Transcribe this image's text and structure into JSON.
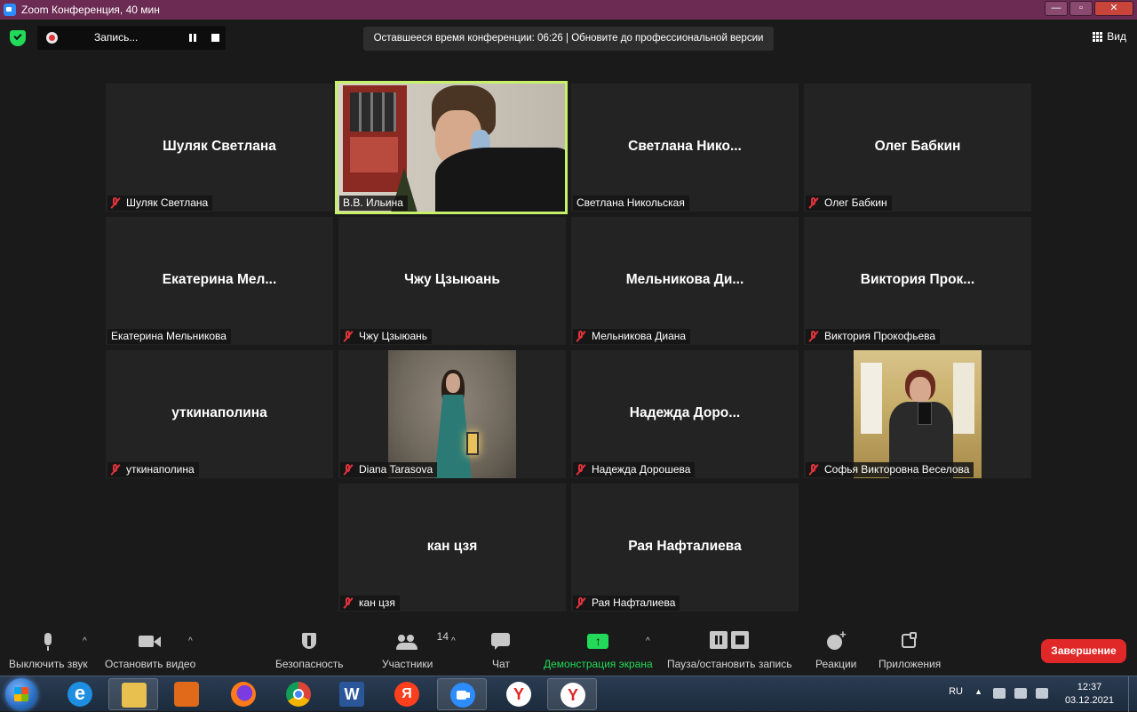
{
  "window": {
    "title": "Zoom Конференция, 40 мин",
    "controls": {
      "minimize": "—",
      "restore": "▫",
      "close": "✕"
    }
  },
  "topbar": {
    "recording_label": "Запись...",
    "notice": "Оставшееся время конференции: 06:26 | Обновите до профессиональной версии",
    "view_label": "Вид"
  },
  "tiles": [
    {
      "big_name": "Шуляк Светлана",
      "tag": "Шуляк Светлана"
    },
    {
      "big_name": "",
      "tag": "В.В. Ильина"
    },
    {
      "big_name": "Светлана  Нико...",
      "tag": "Светлана Никольская"
    },
    {
      "big_name": "Олег Бабкин",
      "tag": "Олег Бабкин"
    },
    {
      "big_name": "Екатерина  Мел...",
      "tag": "Екатерина Мельникова"
    },
    {
      "big_name": "Чжу Цзыюань",
      "tag": "Чжу Цзыюань"
    },
    {
      "big_name": "Мельникова  Ди...",
      "tag": "Мельникова Диана"
    },
    {
      "big_name": "Виктория  Прок...",
      "tag": "Виктория Прокофьева"
    },
    {
      "big_name": "уткинаполина",
      "tag": "уткинаполина"
    },
    {
      "big_name": "",
      "tag": "Diana Tarasova"
    },
    {
      "big_name": "Надежда  Доро...",
      "tag": "Надежда Дорошева"
    },
    {
      "big_name": "",
      "tag": "Софья Викторовна Веселова"
    },
    {
      "big_name": "кан цзя",
      "tag": "кан цзя"
    },
    {
      "big_name": "Рая Нафталиева",
      "tag": "Рая Нафталиева"
    }
  ],
  "toolbar": {
    "mute": "Выключить звук",
    "video": "Остановить видео",
    "security": "Безопасность",
    "participants": "Участники",
    "participants_count": "14",
    "chat": "Чат",
    "share": "Демонстрация экрана",
    "pause_record": "Пауза/остановить запись",
    "reactions": "Реакции",
    "apps": "Приложения",
    "end": "Завершение",
    "caret": "^"
  },
  "taskbar": {
    "lang": "RU",
    "tray_up": "▲",
    "time": "12:37",
    "date": "03.12.2021"
  },
  "colors": {
    "accent_green": "#23d959",
    "end_red": "#e02828",
    "active_speaker": "#c7f06b",
    "mute_red": "#e0333a"
  }
}
